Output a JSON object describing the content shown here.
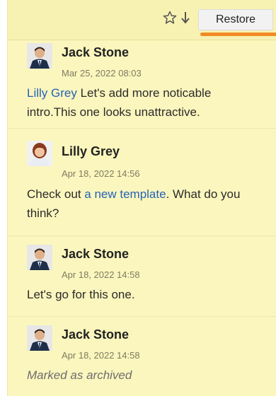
{
  "toolbar": {
    "restore_label": "Restore",
    "star_icon": "star-outline-icon",
    "download_icon": "arrow-down-icon"
  },
  "comments": [
    {
      "author": "Jack Stone",
      "timestamp": "Mar 25, 2022 08:03",
      "mention": "Lilly Grey",
      "text": " Let's add more noticable intro.This one looks unattractive."
    },
    {
      "author": "Lilly Grey",
      "timestamp": "Apr 18, 2022 14:56",
      "text_before": "Check out ",
      "link": "a new template",
      "text_after": ". What do you think?"
    },
    {
      "author": "Jack Stone",
      "timestamp": "Apr 18, 2022 14:58",
      "text": "Let's go for this one."
    },
    {
      "author": "Jack Stone",
      "timestamp": "Apr 18, 2022 14:58",
      "text": "Marked as archived"
    }
  ],
  "colors": {
    "panel_bg": "#fbf6bd",
    "link": "#2563b8",
    "accent": "#f08a22"
  }
}
